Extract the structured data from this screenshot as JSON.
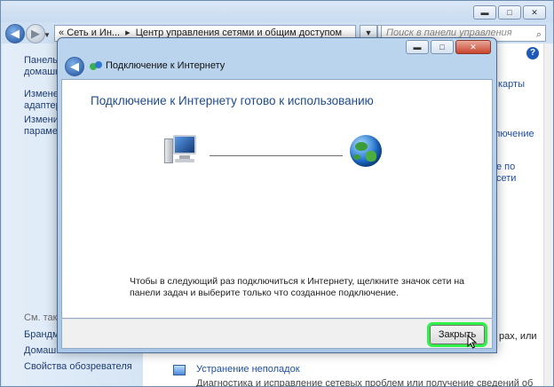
{
  "background": {
    "breadcrumb": {
      "prefix": "«",
      "part1": "Сеть и Ин...",
      "sep": "▸",
      "part2": "Центр управления сетями и общим доступом"
    },
    "search_placeholder": "Поиск в панели управления",
    "left_links": [
      {
        "line1": "Панель у",
        "line2": "домашня"
      },
      {
        "line1": "Изменен",
        "line2": "адаптера"
      },
      {
        "line1": "Изменит",
        "line2": "параметр"
      }
    ],
    "see_also": "См. такж",
    "see_also_links": [
      "Брандма",
      "Домашн",
      "Свойства обозревателя"
    ],
    "right_fragments": {
      "f1": "карты",
      "f2": "лючение",
      "f3a": "е по",
      "f3b": "сети",
      "f4": "рах, или"
    },
    "troubleshoot": {
      "title": "Устранение неполадок",
      "desc": "Диагностика и исправление сетевых проблем или получение сведений об"
    },
    "help": "?"
  },
  "dialog": {
    "title": "Подключение к Интернету",
    "heading": "Подключение к Интернету готово к использованию",
    "note": "Чтобы в следующий раз подключиться к Интернету, щелкните значок сети на панели задач и выберите только что созданное подключение.",
    "close_button": "Закрыть"
  },
  "window_buttons": {
    "minimize": "▬",
    "maximize": "□",
    "close": "✕"
  },
  "colors": {
    "heading": "#1f4b8a",
    "link": "#1f4fa0",
    "highlight": "#2ff14a",
    "close_red": "#c7452c"
  }
}
